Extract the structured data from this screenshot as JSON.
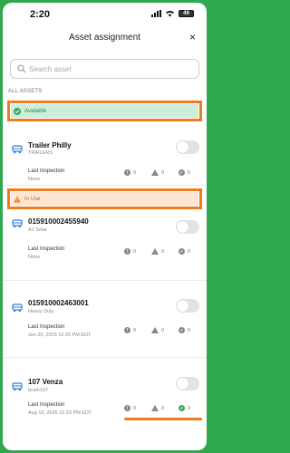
{
  "status": {
    "time": "2:20",
    "battery": "49"
  },
  "header": {
    "title": "Asset assignment",
    "close": "×"
  },
  "search": {
    "placeholder": "Search asset"
  },
  "section_label": "ALL ASSETS",
  "sections": {
    "available": "Available",
    "in_use": "In Use"
  },
  "assets": [
    {
      "name": "Trailer Philly",
      "sub": "TRAILERS",
      "li_label": "Last Inspection",
      "li_value": "None",
      "counts": [
        "0",
        "0",
        "0"
      ]
    },
    {
      "name": "015910002455940",
      "sub": "A1 Solar",
      "li_label": "Last Inspection",
      "li_value": "None",
      "counts": [
        "0",
        "0",
        "0"
      ]
    },
    {
      "name": "015910002463001",
      "sub": "Heavy Duty",
      "li_label": "Last Inspection",
      "li_value": "Jun 20, 2025 12:20 PM EDT",
      "counts": [
        "0",
        "0",
        "0"
      ]
    },
    {
      "name": "107 Venza",
      "sub": "bcwh107",
      "li_label": "Last Inspection",
      "li_value": "Aug 12, 2025 12:23 PM EDT",
      "counts": [
        "0",
        "0",
        "3"
      ]
    }
  ],
  "colors": {
    "accent_highlight": "#f07b1e",
    "available": "#2f8a4e",
    "in_use": "#d0681b",
    "asset_icon": "#2f7fd8"
  },
  "icons": {
    "asset": "bus-icon",
    "info": "info-icon",
    "warning": "warning-icon",
    "check": "check-icon"
  }
}
